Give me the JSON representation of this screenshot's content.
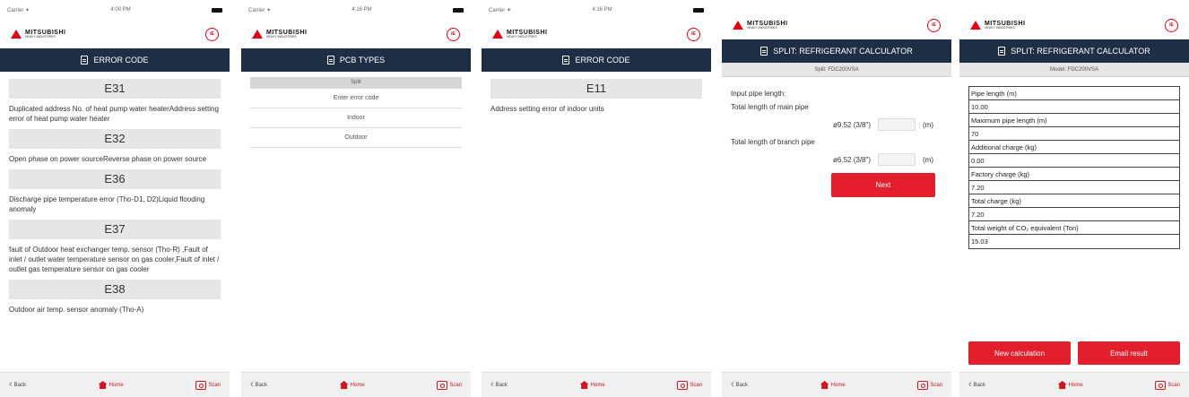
{
  "status": {
    "carrier": "Carrier ✦",
    "time1": "4:09 PM",
    "time2": "4:16 PM",
    "time3": "4:16 PM"
  },
  "brand": {
    "name": "MITSUBISHI",
    "sub": "HEAVY INDUSTRIES",
    "circle_label": "iE"
  },
  "screen1": {
    "title": "ERROR CODE",
    "errors": [
      {
        "code": "E31",
        "desc": "Duplicated address No. of heat pump water heaterAddress setting error of heat pump water heater"
      },
      {
        "code": "E32",
        "desc": "Open phase on power sourceReverse phase on power source"
      },
      {
        "code": "E36",
        "desc": "Discharge pipe temperature error (Tho-D1, D2)Liquid flooding anomaly"
      },
      {
        "code": "E37",
        "desc": "fault of Outdoor heat exchanger temp. sensor (Tho-R) ,Fault of inlet / outlet water temperature sensor on gas cooler,Fault of inlet / outlet gas temperature sensor on gas cooler"
      },
      {
        "code": "E38",
        "desc": "Outdoor air temp. sensor anomaly (Tho-A)"
      }
    ]
  },
  "screen2": {
    "title": "PCB TYPES",
    "head": "Split",
    "items": [
      "Enter error code",
      "Indoor",
      "Outdoor"
    ]
  },
  "screen3": {
    "title": "ERROR CODE",
    "code": "E11",
    "desc": "Address setting error of indoor units"
  },
  "screen4": {
    "title": "SPLIT: REFRIGERANT CALCULATOR",
    "subheader": "Split: FDC200VSA",
    "input_label": "Input pipe length:",
    "main_label": "Total length of main pipe",
    "main_size": "ø9.52 (3/8\")",
    "unit": "(m)",
    "branch_label": "Total length of branch pipe",
    "branch_size": "ø6.52 (3/8\")",
    "next_label": "Next"
  },
  "screen5": {
    "title": "SPLIT: REFRIGERANT CALCULATOR",
    "subheader": "Model: FDC200VSA",
    "fields": [
      {
        "label": "Pipe length (m)",
        "value": "10.00"
      },
      {
        "label": "Maximum pipe length (m)",
        "value": "70"
      },
      {
        "label": "Additional charge (kg)",
        "value": "0.00"
      },
      {
        "label": "Factory charge (kg)",
        "value": "7.20"
      },
      {
        "label": "Total charge (kg)",
        "value": "7.20"
      },
      {
        "label": "Total weight of CO₂ equivalent (Ton)",
        "value": "15.03"
      }
    ],
    "new_calc_label": "New calculation",
    "email_label": "Email result"
  },
  "nav": {
    "back": "Back",
    "home": "Home",
    "scan": "Scan"
  }
}
